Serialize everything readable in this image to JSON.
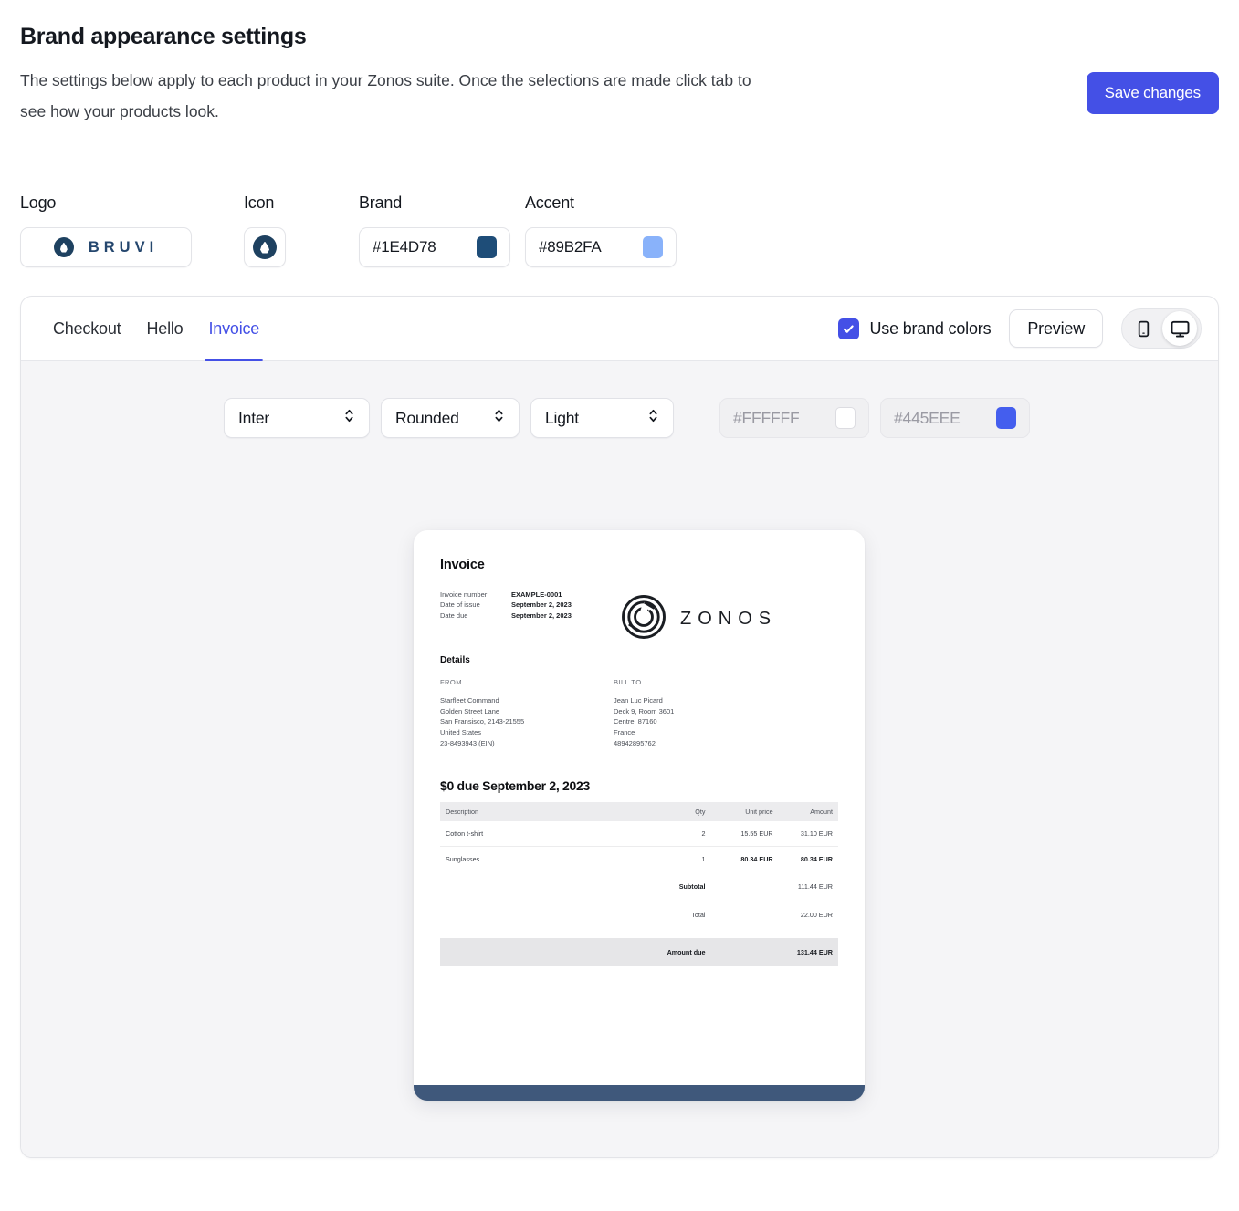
{
  "header": {
    "title": "Brand appearance settings",
    "description": "The settings below apply to each product in your Zonos suite. Once the selections are made click tab to see how your products look.",
    "save_label": "Save changes"
  },
  "brand_row": {
    "logo_label": "Logo",
    "logo_text": "BRUVI",
    "icon_label": "Icon",
    "brand_label": "Brand",
    "brand_value": "#1E4D78",
    "brand_color": "#1E4D78",
    "accent_label": "Accent",
    "accent_value": "#89B2FA",
    "accent_color": "#89B2FA"
  },
  "panel": {
    "tabs": [
      {
        "label": "Checkout",
        "active": false
      },
      {
        "label": "Hello",
        "active": false
      },
      {
        "label": "Invoice",
        "active": true
      }
    ],
    "use_brand_colors_label": "Use brand colors",
    "use_brand_colors_checked": true,
    "preview_label": "Preview",
    "devices": [
      {
        "name": "mobile",
        "active": false
      },
      {
        "name": "desktop",
        "active": true
      }
    ],
    "accent_ui_color": "#4450E6"
  },
  "controls": {
    "font_select": "Inter",
    "corners_select": "Rounded",
    "theme_select": "Light",
    "background_color_value": "#FFFFFF",
    "background_color_swatch": "#FFFFFF",
    "accent_color_value": "#445EEE",
    "accent_color_swatch": "#445EEE"
  },
  "invoice": {
    "title": "Invoice",
    "meta": [
      {
        "key": "Invoice number",
        "value": "EXAMPLE-0001"
      },
      {
        "key": "Date of issue",
        "value": "September 2, 2023"
      },
      {
        "key": "Date due",
        "value": "September 2, 2023"
      }
    ],
    "company_name": "ZONOS",
    "details_heading": "Details",
    "from_heading": "FROM",
    "from_lines": [
      "Starfleet Command",
      "Golden Street Lane",
      "San Fransisco, 2143-21555",
      "United States",
      "23-8493943 (EIN)"
    ],
    "bill_to_heading": "BILL TO",
    "bill_to_lines": [
      "Jean Luc Picard",
      "Deck 9, Room 3601",
      "Centre, 87160",
      "France",
      "48942895762"
    ],
    "due_line": "$0 due September 2, 2023",
    "table": {
      "columns": [
        "Description",
        "Qty",
        "Unit price",
        "Amount"
      ],
      "rows": [
        {
          "description": "Cotton t-shirt",
          "qty": "2",
          "unit_price": "15.55 EUR",
          "amount": "31.10 EUR"
        },
        {
          "description": "Sunglasses",
          "qty": "1",
          "unit_price": "80.34 EUR",
          "amount": "80.34 EUR"
        }
      ],
      "summary": [
        {
          "label": "Subtotal",
          "value": "111.44 EUR"
        },
        {
          "label": "Total",
          "value": "22.00 EUR"
        }
      ],
      "amount_due_label": "Amount due",
      "amount_due_value": "131.44 EUR"
    },
    "footer_bar_color": "#3F587B"
  }
}
